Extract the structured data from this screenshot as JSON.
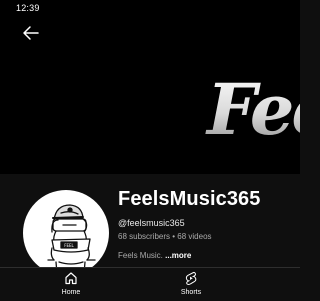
{
  "status_bar": {
    "time": "12:39"
  },
  "banner": {
    "art_text": "Fee"
  },
  "channel": {
    "name": "FeelsMusic365",
    "handle": "@feelsmusic365",
    "stats": "68 subscribers • 68 videos",
    "description": "Feels Music.",
    "more_label": "...more"
  },
  "bottom_nav": {
    "items": [
      {
        "label": "Home",
        "icon": "home-icon"
      },
      {
        "label": "Shorts",
        "icon": "shorts-icon"
      }
    ]
  },
  "colors": {
    "background": "#0f0f0f",
    "text_primary": "#ffffff",
    "text_secondary": "#aaaaaa"
  }
}
